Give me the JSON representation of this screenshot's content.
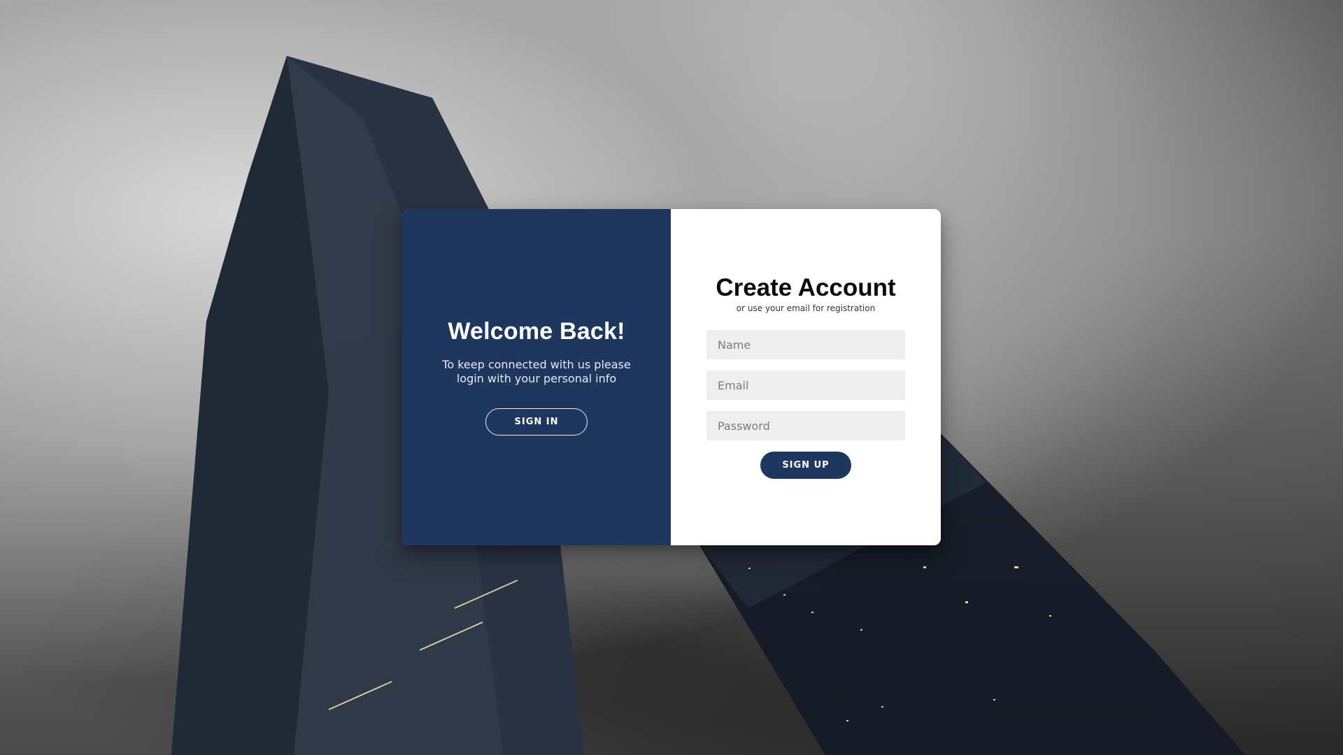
{
  "left_panel": {
    "title": "Welcome Back!",
    "description": "To keep connected with us please login with your personal info",
    "button_label": "SIGN IN"
  },
  "right_panel": {
    "title": "Create Account",
    "subtitle": "or use your email for registration",
    "fields": {
      "name_placeholder": "Name",
      "email_placeholder": "Email",
      "password_placeholder": "Password"
    },
    "button_label": "SIGN UP"
  },
  "colors": {
    "primary": "#1e375f",
    "field_bg": "#eeeeee",
    "card_bg": "#ffffff"
  }
}
